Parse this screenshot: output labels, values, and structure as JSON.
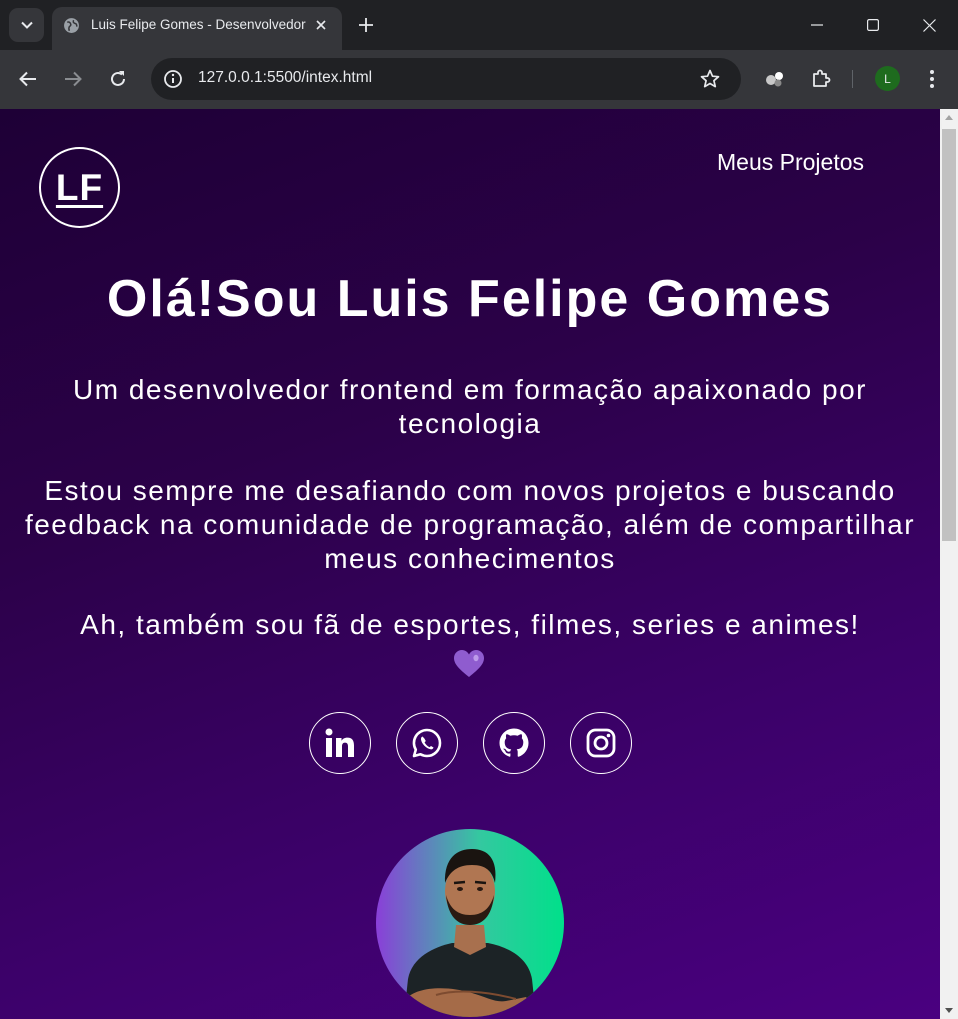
{
  "browser": {
    "tab_title": "Luis Felipe Gomes - Desenvolvedor",
    "url": "127.0.0.1:5500/intex.html",
    "profile_initial": "L"
  },
  "page": {
    "logo_text": "LF",
    "nav_link": "Meus Projetos",
    "hero_title": "Olá!Sou Luis Felipe Gomes",
    "paragraphs": [
      "Um desenvolvedor frontend em formação apaixonado por tecnologia",
      "Estou sempre me desafiando com novos projetos e buscando feedback na comunidade de programação, além de compartilhar meus conhecimentos",
      "Ah, também sou fã de esportes, filmes, series e animes!"
    ],
    "heart_icon": "purple-heart-icon",
    "socials": [
      "linkedin-icon",
      "whatsapp-icon",
      "github-icon",
      "instagram-icon"
    ],
    "colors": {
      "background_top": "#1e0036",
      "background_bottom": "#4a0080",
      "avatar_gradient_left": "#8a3fd8",
      "avatar_gradient_right": "#00e08a",
      "heart": "#9b6bd6"
    }
  }
}
